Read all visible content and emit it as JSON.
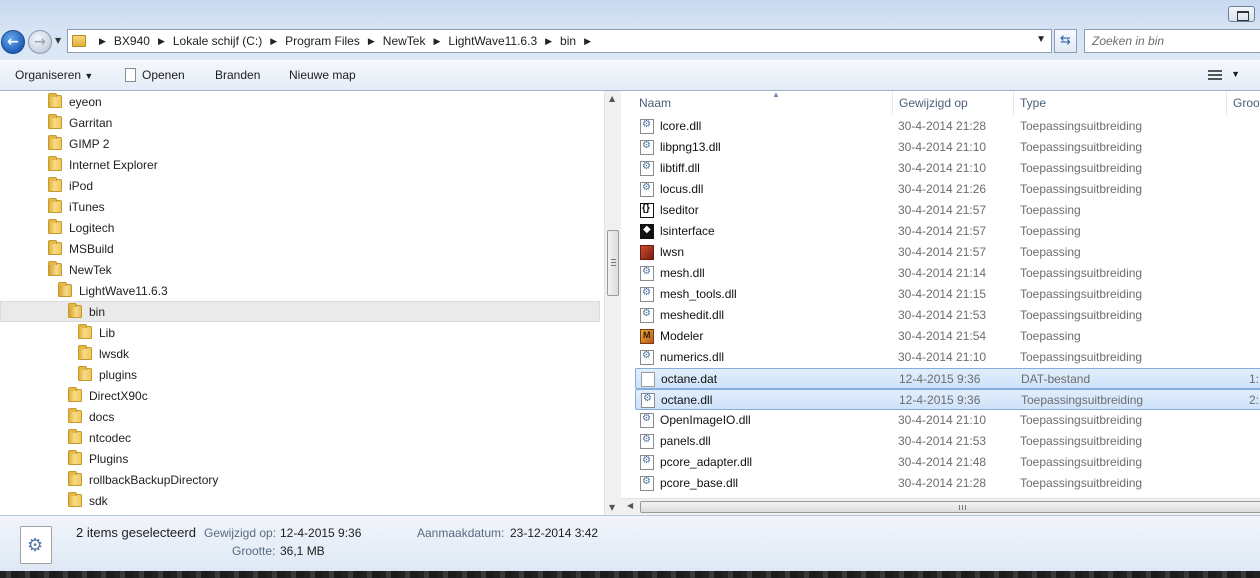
{
  "address_bar": {
    "breadcrumbs": [
      "BX940",
      "Lokale schijf (C:)",
      "Program Files",
      "NewTek",
      "LightWave11.6.3",
      "bin"
    ],
    "search_placeholder": "Zoeken in bin"
  },
  "toolbar": {
    "organize": "Organiseren",
    "open": "Openen",
    "burn": "Branden",
    "new_folder": "Nieuwe map"
  },
  "tree": {
    "items": [
      {
        "label": "eyeon"
      },
      {
        "label": "Garritan"
      },
      {
        "label": "GIMP 2"
      },
      {
        "label": "Internet Explorer"
      },
      {
        "label": "iPod"
      },
      {
        "label": "iTunes"
      },
      {
        "label": "Logitech"
      },
      {
        "label": "MSBuild"
      },
      {
        "label": "NewTek"
      },
      {
        "label": "LightWave11.6.3"
      },
      {
        "label": "bin",
        "selected": true
      },
      {
        "label": "Lib"
      },
      {
        "label": "lwsdk"
      },
      {
        "label": "plugins"
      },
      {
        "label": "DirectX90c"
      },
      {
        "label": "docs"
      },
      {
        "label": "ntcodec"
      },
      {
        "label": "Plugins"
      },
      {
        "label": "rollbackBackupDirectory"
      },
      {
        "label": "sdk"
      }
    ]
  },
  "columns": {
    "name": "Naam",
    "modified": "Gewijzigd op",
    "type": "Type",
    "size": "Groo"
  },
  "files": [
    {
      "name": "lcore.dll",
      "modified": "30-4-2014 21:28",
      "type": "Toepassingsuitbreiding",
      "icon": "dll-icon"
    },
    {
      "name": "libpng13.dll",
      "modified": "30-4-2014 21:10",
      "type": "Toepassingsuitbreiding",
      "icon": "dll-icon"
    },
    {
      "name": "libtiff.dll",
      "modified": "30-4-2014 21:10",
      "type": "Toepassingsuitbreiding",
      "icon": "dll-icon"
    },
    {
      "name": "locus.dll",
      "modified": "30-4-2014 21:26",
      "type": "Toepassingsuitbreiding",
      "icon": "dll-icon"
    },
    {
      "name": "lseditor",
      "modified": "30-4-2014 21:57",
      "type": "Toepassing",
      "icon": "lseditor-icon"
    },
    {
      "name": "lsinterface",
      "modified": "30-4-2014 21:57",
      "type": "Toepassing",
      "icon": "lsinterface-icon"
    },
    {
      "name": "lwsn",
      "modified": "30-4-2014 21:57",
      "type": "Toepassing",
      "icon": "lwsn-icon"
    },
    {
      "name": "mesh.dll",
      "modified": "30-4-2014 21:14",
      "type": "Toepassingsuitbreiding",
      "icon": "dll-icon"
    },
    {
      "name": "mesh_tools.dll",
      "modified": "30-4-2014 21:15",
      "type": "Toepassingsuitbreiding",
      "icon": "dll-icon"
    },
    {
      "name": "meshedit.dll",
      "modified": "30-4-2014 21:53",
      "type": "Toepassingsuitbreiding",
      "icon": "dll-icon"
    },
    {
      "name": "Modeler",
      "modified": "30-4-2014 21:54",
      "type": "Toepassing",
      "icon": "modeler-icon"
    },
    {
      "name": "numerics.dll",
      "modified": "30-4-2014 21:10",
      "type": "Toepassingsuitbreiding",
      "icon": "dll-icon"
    },
    {
      "name": "octane.dat",
      "modified": "12-4-2015 9:36",
      "type": "DAT-bestand",
      "size": "1:",
      "icon": "dat-file-icon",
      "selected": true
    },
    {
      "name": "octane.dll",
      "modified": "12-4-2015 9:36",
      "type": "Toepassingsuitbreiding",
      "size": "2:",
      "icon": "dll-icon",
      "selected": true
    },
    {
      "name": "OpenImageIO.dll",
      "modified": "30-4-2014 21:10",
      "type": "Toepassingsuitbreiding",
      "icon": "dll-icon"
    },
    {
      "name": "panels.dll",
      "modified": "30-4-2014 21:53",
      "type": "Toepassingsuitbreiding",
      "icon": "dll-icon"
    },
    {
      "name": "pcore_adapter.dll",
      "modified": "30-4-2014 21:48",
      "type": "Toepassingsuitbreiding",
      "icon": "dll-icon"
    },
    {
      "name": "pcore_base.dll",
      "modified": "30-4-2014 21:28",
      "type": "Toepassingsuitbreiding",
      "icon": "dll-icon"
    }
  ],
  "details": {
    "title": "2 items geselecteerd",
    "modified_label": "Gewijzigd op:",
    "modified_value": "12-4-2015 9:36",
    "size_label": "Grootte:",
    "size_value": "36,1 MB",
    "created_label": "Aanmaakdatum:",
    "created_value": "23-12-2014 3:42"
  }
}
